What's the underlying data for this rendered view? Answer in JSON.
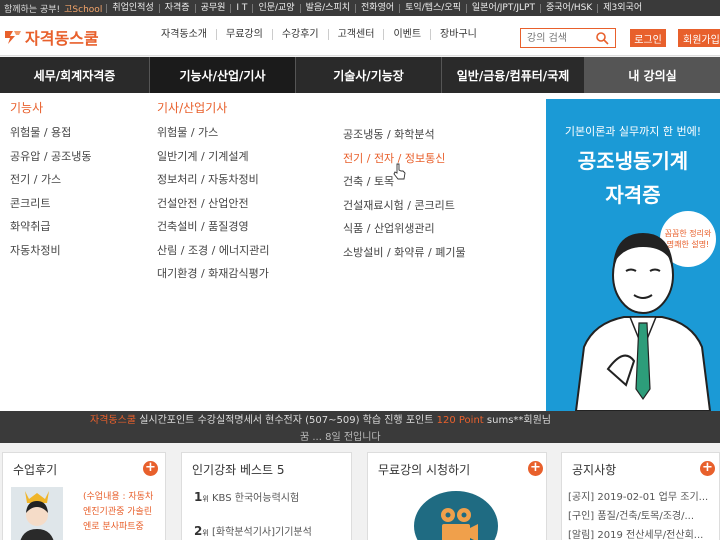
{
  "topbar": {
    "welcome": "함께하는 공부!",
    "brand": "고School",
    "links": [
      "취업인적성",
      "자격증",
      "공무원",
      "I T",
      "인문/교양",
      "발음/스피치",
      "전화영어",
      "토익/텝스/오픽",
      "일본어/JPT/JLPT",
      "중국어/HSK",
      "제3외국어"
    ]
  },
  "header": {
    "logo": "자격동스쿨",
    "nav": [
      "자격동소개",
      "무료강의",
      "수강후기",
      "고객센터",
      "이벤트",
      "장바구니"
    ],
    "search_placeholder": "강의 검색",
    "login_label": "로그인",
    "join_label": "회원가입"
  },
  "categories": [
    "세무/회계자격증",
    "기능사/산업/기사",
    "기술사/기능장",
    "일반/금융/컴퓨터/국제",
    "내 강의실"
  ],
  "dropdown": {
    "col1": {
      "heading": "기능사",
      "items": [
        "위험물 / 용접",
        "공유압 / 공조냉동",
        "전기 / 가스",
        "콘크리트",
        "화약취급",
        "자동차정비"
      ]
    },
    "col2": {
      "heading": "기사/산업기사",
      "items": [
        "위험물 / 가스",
        "일반기계 / 기계설계",
        "정보처리 / 자동차정비",
        "건설안전 / 산업안전",
        "건축설비 / 품질경영",
        "산림 / 조경 / 에너지관리",
        "대기환경 / 화재감식평가"
      ]
    },
    "col3": {
      "items": [
        "공조냉동 / 화학분석",
        "전기 / 전자 / 정보통신",
        "건축 / 토목",
        "건설재료시험 / 콘크리트",
        "식품 / 산업위생관리",
        "소방설비 / 화약류 / 폐기물"
      ]
    }
  },
  "banner": {
    "line1": "기본이론과 실무까지 한 번에!",
    "line2": "공조냉동기계",
    "line3": "자격증",
    "bubble": "꼼꼼한 정리와 명쾌한 설명!"
  },
  "strip": {
    "brand": "자격동스쿨",
    "text": "실시간포인트 수강실적명세서 현수전자 (507~509) 학습 진행 포인트",
    "points": "120 Point",
    "suffix": "sums**회원님",
    "line2": "꿈 ... 8일 전입니다"
  },
  "boxes": {
    "review": {
      "title": "수업후기",
      "lines": [
        "(수업내용 : 자동차",
        "엔진기관중 가솔린",
        "엔로 분사파트중"
      ]
    },
    "best": {
      "title": "인기강좌 베스트 5",
      "items": [
        {
          "rank": "1",
          "suffix": "위",
          "text": "KBS 한국어능력시험"
        },
        {
          "rank": "2",
          "suffix": "위",
          "text": "[화학분석기사]기기분석"
        }
      ]
    },
    "free": {
      "title": "무료강의 시청하기"
    },
    "notice": {
      "title": "공지사항",
      "items": [
        "[공지] 2019-02-01 업무 조기...",
        "[구인] 품질/건축/토목/조경/...",
        "[알림] 2019 전산세무/전산회..."
      ]
    }
  }
}
